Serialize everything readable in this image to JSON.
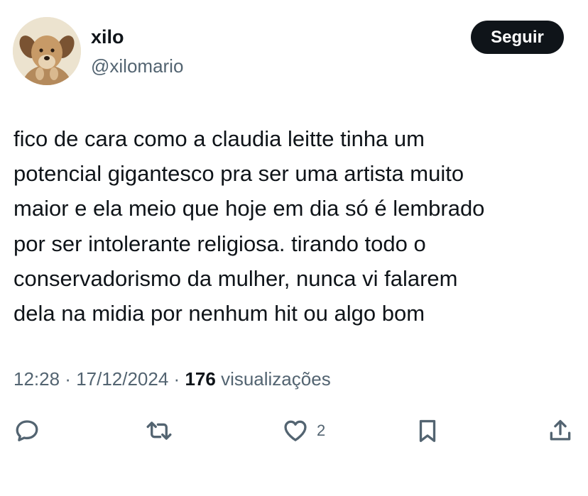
{
  "user": {
    "display_name": "xilo",
    "handle": "@xilomario",
    "avatar_icon": "dog-avatar"
  },
  "follow_button": {
    "label": "Seguir",
    "background": "#0f1419",
    "color": "#ffffff"
  },
  "tweet": {
    "lines": [
      "fico de cara como a claudia leitte tinha um",
      "potencial gigantesco pra ser uma artista muito",
      "maior e ela meio que hoje em dia só é lembrado",
      "por ser intolerante religiosa. tirando todo o",
      "conservadorismo da mulher, nunca vi falarem",
      "dela na midia por nenhum hit ou algo bom"
    ]
  },
  "meta": {
    "time": "12:28",
    "separator": " · ",
    "date": "17/12/2024",
    "views_count": "176",
    "views_label": "visualizações"
  },
  "actions": {
    "reply_icon": "reply-icon",
    "retweet_icon": "retweet-icon",
    "like_icon": "heart-icon",
    "like_count": "2",
    "bookmark_icon": "bookmark-icon",
    "share_icon": "share-icon"
  },
  "colors": {
    "text_primary": "#0f1419",
    "text_secondary": "#536471",
    "icon": "#536471",
    "background": "#ffffff"
  }
}
